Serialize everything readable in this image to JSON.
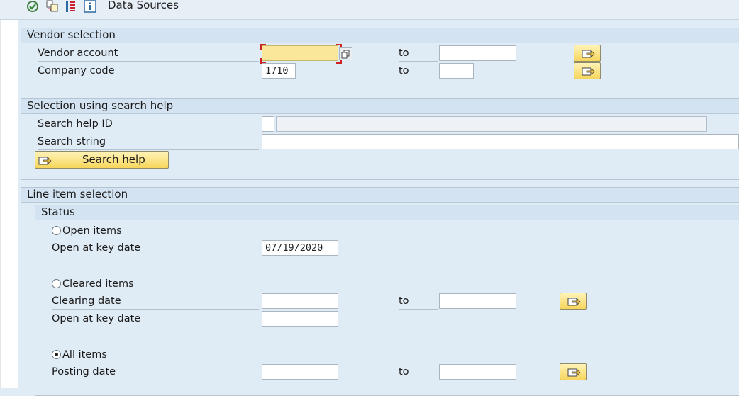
{
  "toolbar": {
    "icons": [
      "execute-icon",
      "copy-structure-icon",
      "list-icon",
      "info-icon"
    ],
    "data_sources_label": "Data Sources"
  },
  "vendor_selection": {
    "title": "Vendor selection",
    "vendor_account": {
      "label": "Vendor account",
      "value": "",
      "to_label": "to",
      "to_value": ""
    },
    "company_code": {
      "label": "Company code",
      "value": "1710",
      "to_label": "to",
      "to_value": ""
    }
  },
  "search_help_selection": {
    "title": "Selection using search help",
    "search_help_id": {
      "label": "Search help ID",
      "value": "",
      "description": ""
    },
    "search_string": {
      "label": "Search string",
      "value": ""
    },
    "search_help_button": "Search help"
  },
  "line_item_selection": {
    "title": "Line item selection",
    "status": {
      "title": "Status",
      "open_items": {
        "label": "Open items",
        "selected": false,
        "key_date_label": "Open at key date",
        "key_date_value": "07/19/2020"
      },
      "cleared_items": {
        "label": "Cleared items",
        "selected": false,
        "clearing_date_label": "Clearing date",
        "clearing_from": "",
        "to_label": "to",
        "clearing_to": "",
        "key_date_label": "Open at key date",
        "key_date_value": ""
      },
      "all_items": {
        "label": "All items",
        "selected": true,
        "posting_date_label": "Posting date",
        "posting_from": "",
        "to_label": "to",
        "posting_to": ""
      }
    }
  },
  "colors": {
    "background": "#dfebf5",
    "button_yellow": "#f7d65c",
    "focus_field": "#fbe79a"
  }
}
